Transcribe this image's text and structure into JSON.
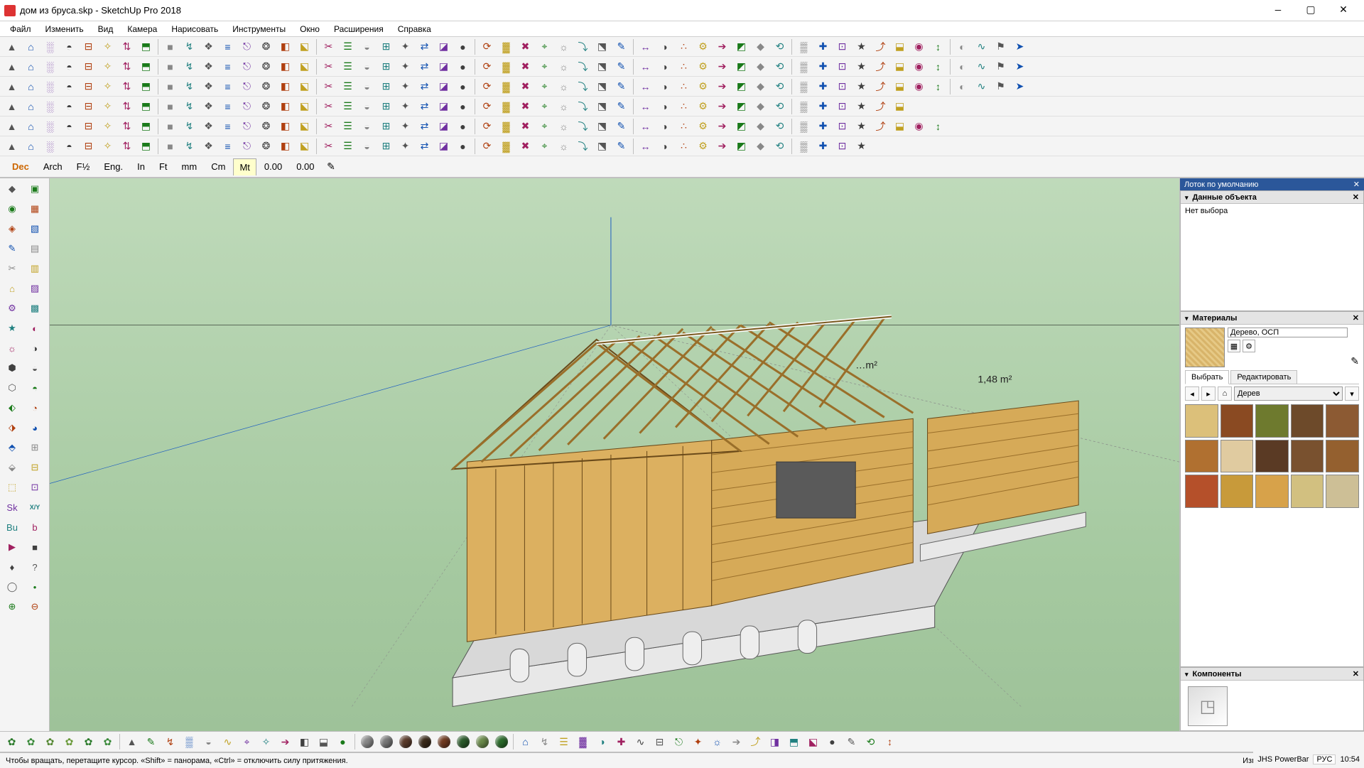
{
  "window": {
    "title": "дом из бруса.skp - SketchUp Pro 2018",
    "buttons": {
      "min": "—",
      "max": "▢",
      "close": "✕"
    }
  },
  "menu": [
    "Файл",
    "Изменить",
    "Вид",
    "Камера",
    "Нарисовать",
    "Инструменты",
    "Окно",
    "Расширения",
    "Справка"
  ],
  "unit_tabs": [
    "Dec",
    "Arch",
    "F½",
    "Eng.",
    "In",
    "Ft",
    "mm",
    "Cm",
    "Mt",
    "0.00",
    "0.00"
  ],
  "unit_active": "Mt",
  "tray": {
    "title": "Лоток по умолчанию",
    "sections": {
      "entity": {
        "title": "Данные объекта",
        "body": "Нет выбора"
      },
      "materials": {
        "title": "Материалы",
        "current_name": "Дерево, ОСП",
        "tab_select": "Выбрать",
        "tab_edit": "Редактировать",
        "category": "Дерев",
        "swatches": [
          "#dcc07a",
          "#8a4a22",
          "#6e7a2e",
          "#6d4a2a",
          "#8c5a33",
          "#b07030",
          "#e0cba0",
          "#5a3a24",
          "#79512f",
          "#94602f",
          "#b5502a",
          "#c89a3a",
          "#d7a24a",
          "#d2c080",
          "#cdbf96"
        ]
      },
      "components": {
        "title": "Компоненты"
      }
    }
  },
  "viewport_labels": {
    "area1": "…m²",
    "area2": "1,48 m²"
  },
  "status": {
    "hint": "Чтобы вращать, перетащите курсор. «Shift» = панорама, «Ctrl» = отключить силу притяжения.",
    "measure_label": "Измере",
    "powerbar": "JHS PowerBar"
  },
  "system": {
    "lang": "РУС",
    "time": "10:54"
  }
}
